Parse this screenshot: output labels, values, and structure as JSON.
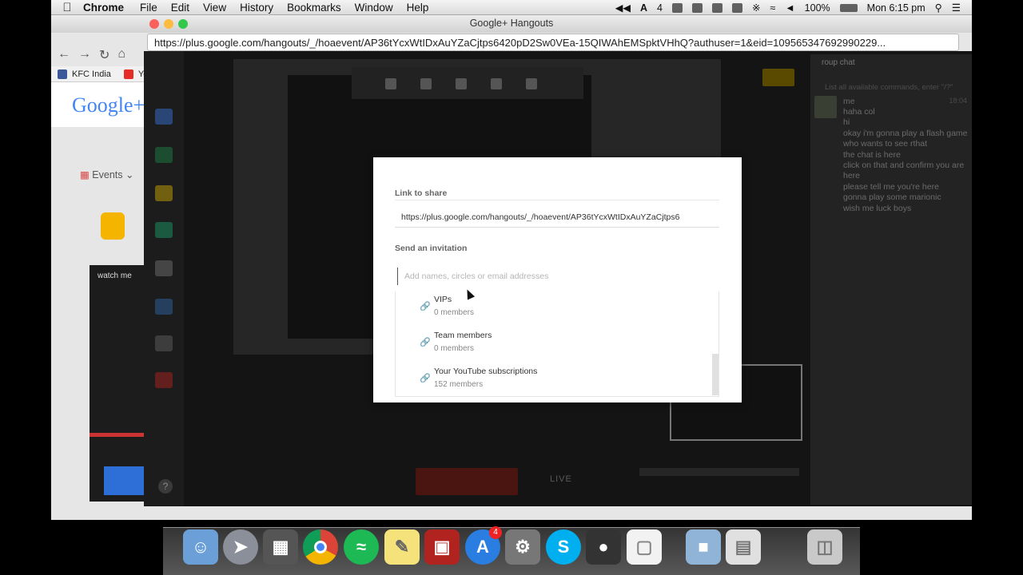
{
  "menubar": {
    "app_name": "Chrome",
    "items": [
      "File",
      "Edit",
      "View",
      "History",
      "Bookmarks",
      "Window",
      "Help"
    ],
    "status_number": "4",
    "battery": "100%",
    "clock": "Mon 6:15 pm"
  },
  "window": {
    "title": "Google+ Hangouts",
    "url": "https://plus.google.com/hangouts/_/hoaevent/AP36tYcxWtIDxAuYZaCjtps6420pD2Sw0VEa-15QIWAhEMSpktVHhQ?authuser=1&eid=109565347692990229..."
  },
  "bookmarks": {
    "items": [
      "KFC India",
      "Yo"
    ]
  },
  "page": {
    "logo": "Google+",
    "events_tab": "Events",
    "events_card_title": "watch me"
  },
  "chat": {
    "title": "roup chat",
    "hint": "List all available commands, enter \"/?\"",
    "sender": "me",
    "time": "18:04",
    "messages": [
      "haha col",
      "hi",
      "okay i'm gonna play a flash game",
      "who wants to see rthat",
      "the chat is here",
      "click on that and confirm you are here",
      "please tell me you're here",
      "gonna play some marionic",
      "wish me luck boys"
    ]
  },
  "hangout": {
    "live_label": "LIVE"
  },
  "modal": {
    "link_label": "Link to share",
    "link_value": "https://plus.google.com/hangouts/_/hoaevent/AP36tYcxWtIDxAuYZaCjtps6",
    "invite_label": "Send an invitation",
    "invite_placeholder": "Add names, circles or email addresses",
    "suggestions": [
      {
        "name": "VIPs",
        "count": "0 members"
      },
      {
        "name": "Team members",
        "count": "0 members"
      },
      {
        "name": "Your YouTube subscriptions",
        "count": "152 members"
      }
    ]
  },
  "dock": {
    "badge_count": "4"
  },
  "colors": {
    "link_icon": "#222222",
    "chrome_red": "#db4437",
    "chrome_yellow": "#f4b400",
    "chrome_green": "#0f9d58",
    "spotify_green": "#1db954",
    "skype_blue": "#00aff0"
  }
}
